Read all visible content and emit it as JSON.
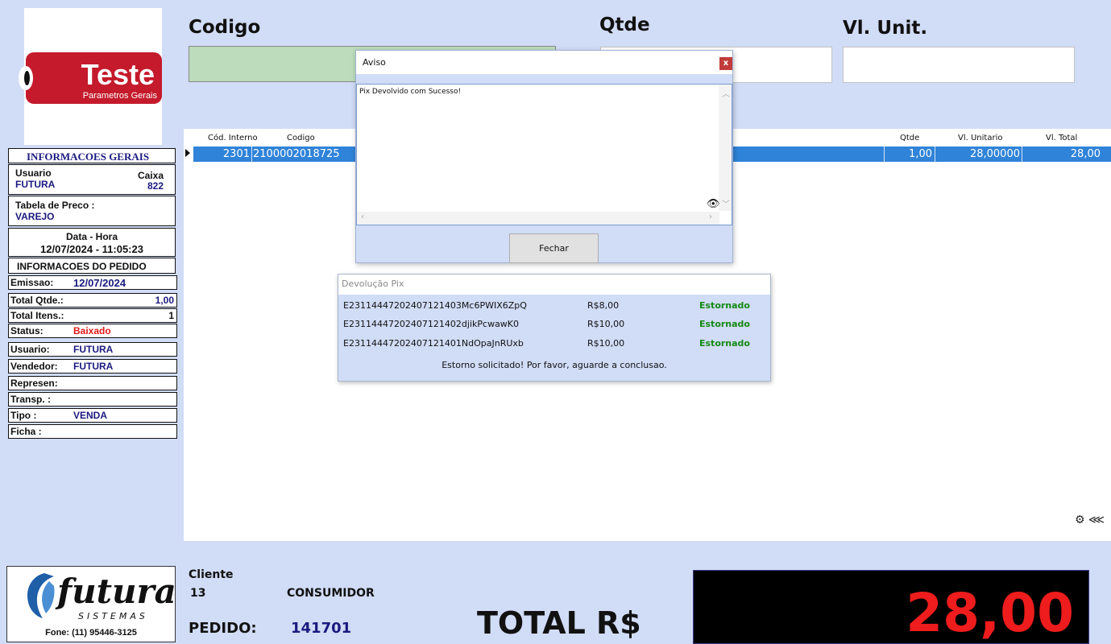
{
  "brand": {
    "title": "Teste",
    "subtitle": "Parametros Gerais"
  },
  "info_general": {
    "header": "INFORMACOES GERAIS",
    "usuario_label": "Usuario",
    "usuario_value": "FUTURA",
    "caixa_label": "Caixa",
    "caixa_value": "822",
    "tabela_label": "Tabela de Preco :",
    "tabela_value": "VAREJO",
    "datahora_label": "Data - Hora",
    "datahora_value": "12/07/2024 - 11:05:23"
  },
  "order_info": {
    "header": "INFORMACOES DO PEDIDO",
    "emissao_label": "Emissao:",
    "emissao_value": "12/07/2024",
    "total_qtde_label": "Total Qtde.:",
    "total_qtde_value": "1,00",
    "total_itens_label": "Total Itens.:",
    "total_itens_value": "1",
    "status_label": "Status:",
    "status_value": "Baixado",
    "usuario_label": "Usuario:",
    "usuario_value": "FUTURA",
    "vendedor_label": "Vendedor:",
    "vendedor_value": "FUTURA",
    "represen_label": "Represen:",
    "transp_label": "Transp. :",
    "tipo_label": "Tipo :",
    "tipo_value": "VENDA",
    "ficha_label": "Ficha :"
  },
  "company": {
    "name": "futura",
    "tagline": "SISTEMAS",
    "phone": "Fone: (11) 95446-3125"
  },
  "entry": {
    "codigo_label": "Codigo",
    "qtde_label": "Qtde",
    "vl_unit_label": "Vl. Unit."
  },
  "grid": {
    "headers": {
      "cod_interno": "Cód. Interno",
      "codigo": "Codigo",
      "qtde": "Qtde",
      "vl_unitario": "Vl. Unitario",
      "vl_total": "Vl. Total"
    },
    "row": {
      "cod_interno": "2301",
      "codigo": "2100002018725",
      "qtde": "1,00",
      "vl_unitario": "28,00000",
      "vl_total": "28,00"
    }
  },
  "bottom": {
    "cliente_label": "Cliente",
    "cliente_code": "13",
    "cliente_name": "CONSUMIDOR",
    "pedido_label": "PEDIDO:",
    "pedido_value": "141701",
    "total_label": "TOTAL R$",
    "total_value": "28,00"
  },
  "aviso_dialog": {
    "title": "Aviso",
    "close": "x",
    "message": "Pix Devolvido com Sucesso!",
    "button": "Fechar"
  },
  "pix_panel": {
    "title": "Devolução Pix",
    "rows": [
      {
        "id": "E23114447202407121403Mc6PWIX6ZpQ",
        "value": "R$8,00",
        "status": "Estornado"
      },
      {
        "id": "E23114447202407121402djikPcwawK0",
        "value": "R$10,00",
        "status": "Estornado"
      },
      {
        "id": "E23114447202407121401NdOpaJnRUxb",
        "value": "R$10,00",
        "status": "Estornado"
      }
    ],
    "message": "Estorno solicitado! Por favor, aguarde a conclusao."
  },
  "colors": {
    "panel_bg": "#d1dcf6",
    "brand_red": "#c41a2b",
    "selected_row": "#2f83d8",
    "total_red": "#ee1c1c",
    "status_green": "#138a13"
  },
  "icons": {
    "settings": "settings-icon",
    "share": "share-icon",
    "eye": "eye-icon"
  }
}
